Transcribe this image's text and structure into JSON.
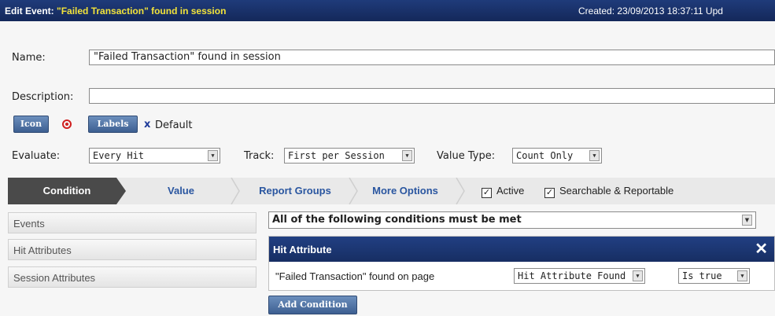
{
  "title_bar": {
    "prefix": "Edit Event: ",
    "event_name": "\"Failed Transaction\" found in session",
    "right_text": "Created: 23/09/2013 18:37:11   Upd"
  },
  "form": {
    "name_label": "Name:",
    "name_value": "\"Failed Transaction\" found in session",
    "description_label": "Description:",
    "description_value": "",
    "icon_button": "Icon",
    "labels_button": "Labels",
    "label_remove": "x",
    "label_default": "Default",
    "evaluate_label": "Evaluate:",
    "evaluate_value": "Every Hit",
    "track_label": "Track:",
    "track_value": "First per Session",
    "value_type_label": "Value Type:",
    "value_type_value": "Count Only"
  },
  "tabs": [
    "Condition",
    "Value",
    "Report Groups",
    "More Options"
  ],
  "checkboxes": {
    "active_label": "Active",
    "searchable_label": "Searchable & Reportable",
    "check_glyph": "✓"
  },
  "sidebar": {
    "items": [
      "Events",
      "Hit Attributes",
      "Session Attributes"
    ]
  },
  "conditions": {
    "match_mode": "All of the following conditions must be met",
    "hit_attribute": {
      "title": "Hit Attribute",
      "close": "✕",
      "name": "\"Failed Transaction\" found on page",
      "operator": "Hit Attribute Found",
      "value": "Is true"
    },
    "add_button": "Add Condition"
  },
  "colors": {
    "title_bg": "#1f3b7a",
    "title_accent": "#f2e33a",
    "tab_active_bg": "#4a4a4a",
    "tab_link": "#2a56a0",
    "button_blue": "#4f72a6"
  }
}
